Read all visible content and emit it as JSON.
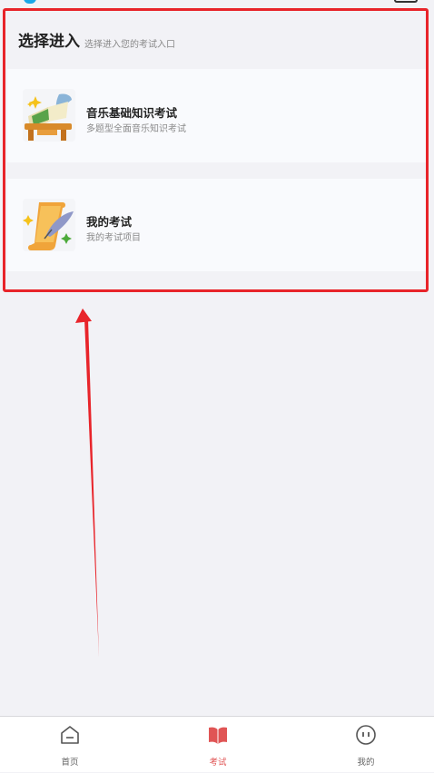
{
  "section": {
    "title": "选择进入",
    "subtitle": "选择进入您的考试入口"
  },
  "cards": [
    {
      "title": "音乐基础知识考试",
      "desc": "多题型全面音乐知识考试",
      "icon": "open-book-on-desk-icon"
    },
    {
      "title": "我的考试",
      "desc": "我的考试项目",
      "icon": "scroll-and-quill-icon"
    }
  ],
  "tabs": [
    {
      "label": "首页",
      "icon": "home-icon",
      "active": false
    },
    {
      "label": "考试",
      "icon": "book-icon",
      "active": true
    },
    {
      "label": "我的",
      "icon": "face-icon",
      "active": false
    }
  ],
  "colors": {
    "accent": "#e05555",
    "annotation": "#e8242a",
    "background": "#f2f2f6"
  }
}
